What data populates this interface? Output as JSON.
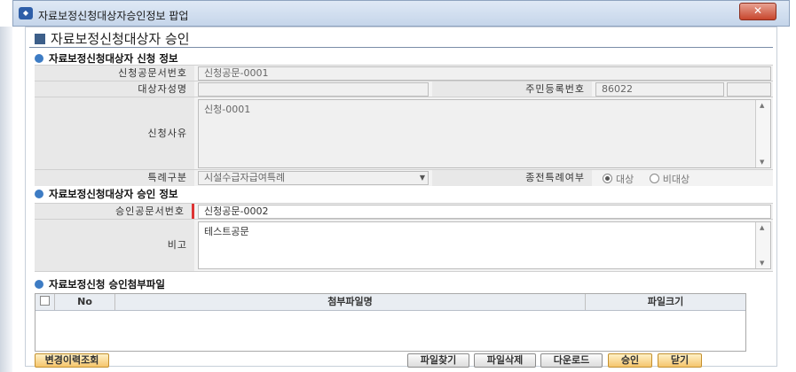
{
  "window": {
    "title": "자료보정신청대상자승인정보 팝업",
    "close": "✕"
  },
  "page_title": "자료보정신청대상자 승인",
  "apply_section": {
    "header": "자료보정신청대상자 신청 정보",
    "doc_no_label": "신청공문서번호",
    "doc_no_value": "신청공문-0001",
    "name_label": "대상자성명",
    "name_value": "",
    "rrn_label": "주민등록번호",
    "rrn_value": "86022",
    "reason_label": "신청사유",
    "reason_value": "신청-0001",
    "exception_label": "특례구분",
    "exception_value": "시설수급자급여특례",
    "prior_label": "종전특례여부",
    "prior_options": [
      "대상",
      "비대상"
    ],
    "prior_selected": "대상"
  },
  "approve_section": {
    "header": "자료보정신청대상자 승인 정보",
    "doc_no_label": "승인공문서번호",
    "doc_no_value": "신청공문-0002",
    "note_label": "비고",
    "note_value": "테스트공문"
  },
  "attach_section": {
    "header": "자료보정신청 승인첨부파일",
    "columns": [
      "No",
      "첨부파일명",
      "파일크기"
    ]
  },
  "buttons": {
    "history": "변경이력조회",
    "find": "파일찾기",
    "delete": "파일삭제",
    "download": "다운로드",
    "approve": "승인",
    "close": "닫기"
  }
}
